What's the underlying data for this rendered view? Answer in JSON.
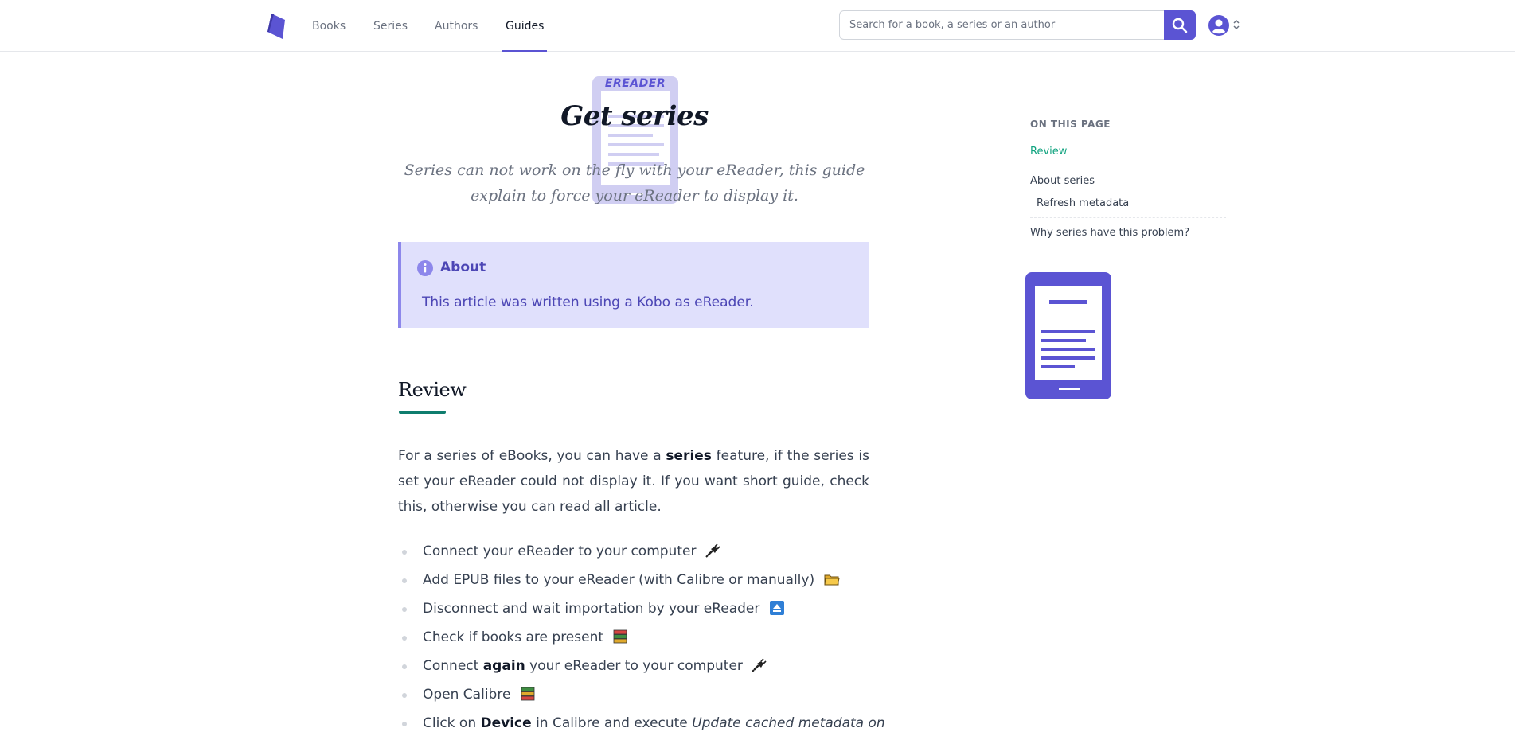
{
  "nav": {
    "items": [
      {
        "label": "Books"
      },
      {
        "label": "Series"
      },
      {
        "label": "Authors"
      },
      {
        "label": "Guides"
      }
    ],
    "active": "Guides"
  },
  "search": {
    "placeholder": "Search for a book, a series or an author",
    "value": ""
  },
  "article": {
    "hero_label": "EREADER",
    "title": "Get series",
    "subtitle": "Series can not work on the fly with your eReader, this guide explain to force your eReader to display it.",
    "callout": {
      "title": "About",
      "text": "This article was written using a Kobo as eReader."
    },
    "section_heading": "Review",
    "paragraph": {
      "before": "For a series of eBooks, you can have a ",
      "bold": "series",
      "after": " feature, if the series is set your eReader could not display it. If you want short guide, check this, oth­erwise you can read all article."
    },
    "steps": {
      "s1": "Connect your eReader to your computer",
      "s2": "Add EPUB files to your eReader (with Calibre or manually)",
      "s3": "Disconnect and wait importation by your eReader",
      "s4": "Check if books are present",
      "s5_pre": "Connect ",
      "s5_bold": "again",
      "s5_post": " your eReader to your computer",
      "s6": "Open Calibre",
      "s7_pre": "Click on ",
      "s7_bold": "Device",
      "s7_mid": " in Calibre and execute ",
      "s7_italic": "Update cached metadata on"
    },
    "step_icons": [
      "plug-icon",
      "folder-icon",
      "eject-icon",
      "books-icon",
      "plug-icon",
      "books-icon"
    ]
  },
  "toc": {
    "title": "ON THIS PAGE",
    "items": [
      {
        "label": "Review"
      },
      {
        "label": "About series"
      },
      {
        "label": "Refresh metadata"
      },
      {
        "label": "Why series have this problem?"
      }
    ],
    "active": "Review"
  },
  "colors": {
    "accent": "#5b54d3",
    "callout_bg": "#e0e0fc",
    "toc_active": "#10a37f",
    "heading_underline": "#0f7d6e"
  }
}
